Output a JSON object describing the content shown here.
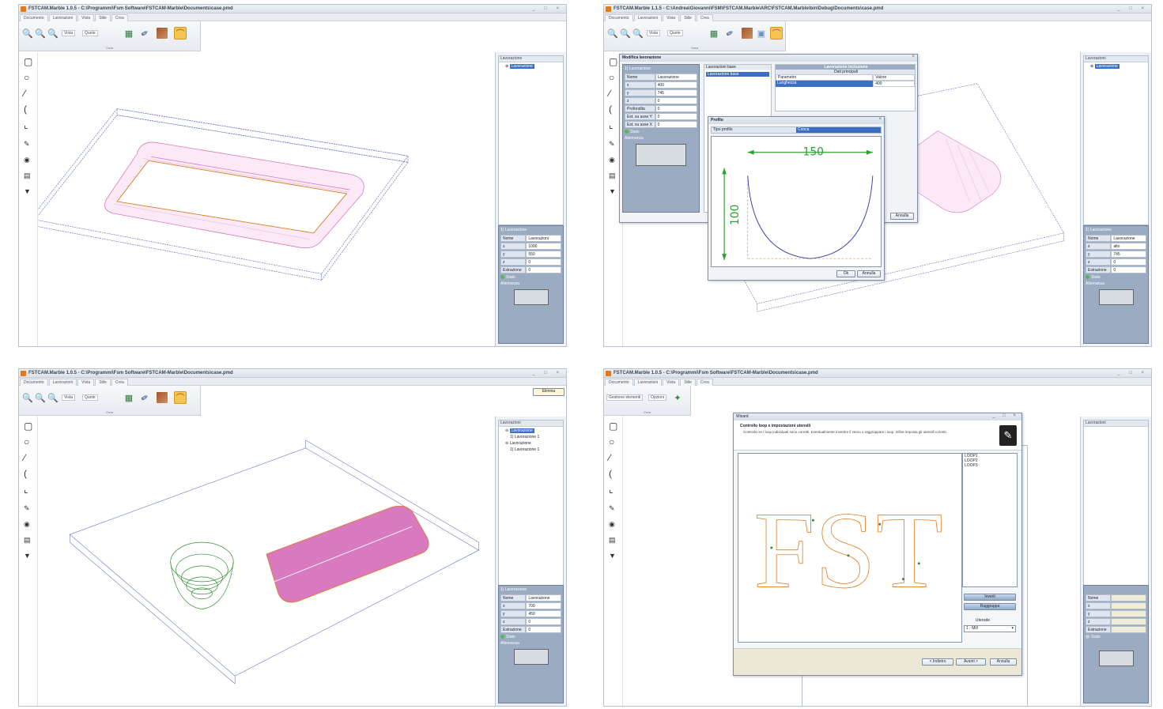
{
  "screens": [
    {
      "title": "FSTCAM.Marble 1.0.5 - C:\\Programmi\\Fsm Software\\FSTCAM-Marble\\Documents\\case.pmd",
      "window_controls": "_ □ ×",
      "menu_tabs": [
        "Documento",
        "Lavorazioni",
        "Vista",
        "Stile",
        "Crea"
      ],
      "ribbon_dropdowns": [
        "Vista",
        "Quote"
      ],
      "ribbon_group": "Crea",
      "tree_header": "Lavorazione",
      "tree_nodes": [
        "Lavorazione"
      ],
      "props_title": "1) Lavorazione",
      "props": [
        {
          "k": "Nome",
          "v": "Lavorazioni"
        },
        {
          "k": "x",
          "v": "1000"
        },
        {
          "k": "y",
          "v": "550"
        },
        {
          "k": "z",
          "v": "0"
        },
        {
          "k": "Estrazione",
          "v": "0"
        }
      ],
      "stato": "Stato",
      "alternanza": "Alternanza"
    },
    {
      "title": "FSTCAM.Marble 1.1.5 - C:\\Andrea\\Giovanni\\FSM\\FSTCAM.Marble\\ARC\\FSTCAM.Marble\\bin\\Debug\\Documents\\case.pmd",
      "window_controls": "_ □ ×",
      "menu_tabs": [
        "Documento",
        "Lavorazioni",
        "Vista",
        "Stile",
        "Crea"
      ],
      "ribbon_dropdowns": [
        "Vista",
        "Quote"
      ],
      "ribbon_group": "Crea",
      "tree_header": "Lavorazioni",
      "tree_nodes": [
        "Lavorazione"
      ],
      "props_title": "1) Lavorazione",
      "props": [
        {
          "k": "Nome",
          "v": "Lavorazione"
        },
        {
          "k": "x",
          "v": "alto"
        },
        {
          "k": "y",
          "v": "745"
        },
        {
          "k": "z",
          "v": "0"
        },
        {
          "k": "Estrazione",
          "v": "0"
        }
      ],
      "stato": "Stato",
      "alternanza": "Alternanza",
      "modifica_dialog": {
        "title": "Modifica lavorazione",
        "left_header": "1) Lavorazione",
        "rows": [
          {
            "k": "Nome",
            "v": "Lavorazione"
          },
          {
            "k": "x",
            "v": "400"
          },
          {
            "k": "y",
            "v": "745"
          },
          {
            "k": "z",
            "v": "0"
          },
          {
            "k": "Profondita",
            "v": "0"
          },
          {
            "k": "Est. su asse Y",
            "v": "0"
          },
          {
            "k": "Est. su asse X",
            "v": "0"
          }
        ],
        "stato": "Stato",
        "alternanza": "Alternanza",
        "mid_header": "Lavorazioni base",
        "mid_selected": "Lavorazione base",
        "right_header": "Lavorazione inclusione",
        "right_sub": "Dati principali",
        "param_col": "Parametro",
        "value_col": "Valore",
        "param_row": {
          "k": "Lunghezza",
          "v": "400"
        },
        "footer": "Annulla"
      },
      "profilo_dialog": {
        "title": "Profilo",
        "tipo_label": "Tipo profilo",
        "tipo_value": "Conca",
        "width_label": "150",
        "height_label": "100",
        "ok": "Ok",
        "cancel": "Annulla"
      }
    },
    {
      "title": "FSTCAM.Marble 1.0.5 - C:\\Programmi\\Fsm Software\\FSTCAM-Marble\\Documents\\case.pmd",
      "window_controls": "_ □ ×",
      "menu_tabs": [
        "Documento",
        "Lavorazioni",
        "Vista",
        "Stile",
        "Crea"
      ],
      "ribbon_dropdowns": [
        "Vista",
        "Quote"
      ],
      "ribbon_group": "Crea",
      "corner_button": "Elimina",
      "tree_header": "Lavorazioni",
      "tree_nodes": [
        "Lavorazione",
        "1) Lavorazione 1",
        "Lavorazione",
        "1) Lavorazione 1"
      ],
      "props_title": "1) Lavorazione",
      "props": [
        {
          "k": "Nome",
          "v": "Lavorazione"
        },
        {
          "k": "x",
          "v": "700"
        },
        {
          "k": "y",
          "v": "450"
        },
        {
          "k": "z",
          "v": "0"
        },
        {
          "k": "Estrazione",
          "v": "0"
        }
      ],
      "stato": "Stato",
      "alternanza": "Alternanza"
    },
    {
      "title": "FSTCAM.Marble 1.0.5 - C:\\Programmi\\Fsm Software\\FSTCAM-Marble\\Documents\\case.pmd",
      "window_controls": "_ □ ×",
      "menu_tabs": [
        "Documento",
        "Lavorazioni",
        "Vista",
        "Stile",
        "Crea"
      ],
      "ribbon_dropdowns": [
        "Gestione elementi",
        "Opzioni"
      ],
      "ribbon_group": "Crea",
      "tree_header": "Lavorazioni",
      "tree_nodes": [],
      "props_title": "",
      "props": [
        {
          "k": "Nome",
          "v": ""
        },
        {
          "k": "x",
          "v": ""
        },
        {
          "k": "y",
          "v": ""
        },
        {
          "k": "z",
          "v": ""
        },
        {
          "k": "Estrazione",
          "v": ""
        }
      ],
      "stato": "Stato",
      "alternanza": "",
      "wizard": {
        "title": "Wizard",
        "heading": "Controllo loop e impostazioni utensili",
        "desc": "Controllo se i loop individuati sono corretti. Eventualmente invertire il verso o raggruppare i loop. Infine imposta gli utensili corretti.",
        "loops": [
          "LOOP1",
          "LOOP2",
          "LOOP3"
        ],
        "big_text": "FST",
        "btn_inverti": "Inverti",
        "btn_raggruppa": "Raggruppa",
        "utensile_label": "Utensile",
        "utensile_value": "1 - Mill",
        "back": "< Indietro",
        "next": "Avanti >",
        "cancel": "Annulla"
      }
    }
  ],
  "colors": {
    "pocket": "#d979c0",
    "outline": "#3b44a8",
    "orange": "#e07a1a",
    "green": "#2f8f2f",
    "panel": "#9aabc2"
  }
}
